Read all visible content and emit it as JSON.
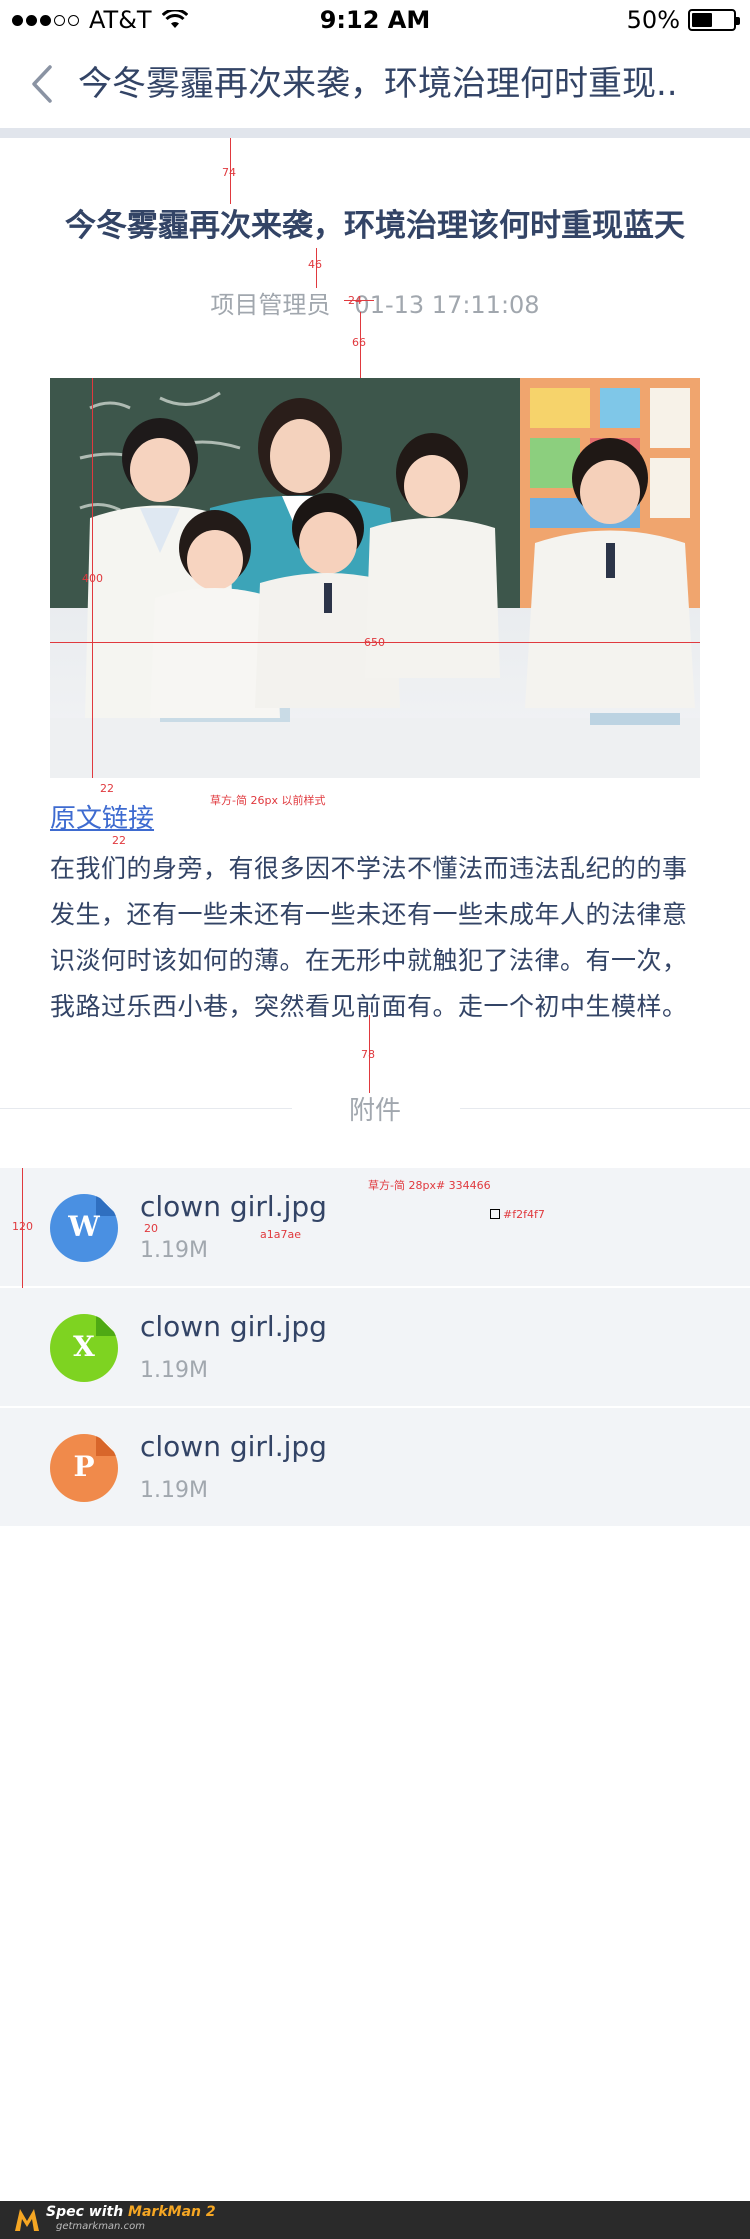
{
  "status_bar": {
    "carrier": "AT&T",
    "time": "9:12 AM",
    "battery": "50%",
    "battery_level": 0.5
  },
  "nav": {
    "title": "今冬雾霾再次来袭，环境治理何时重现.."
  },
  "article": {
    "title": "今冬雾霾再次来袭，环境治理该何时重现蓝天",
    "author": "项目管理员",
    "datetime": "01-13 17:11:08",
    "source_link": "原文链接",
    "body": "在我们的身旁，有很多因不学法不懂法而违法乱纪的的事发生，还有一些未还有一些未还有一些未成年人的法律意识淡何时该如何的薄。在无形中就触犯了法律。有一次，我路过乐西小巷，突然看见前面有。走一个初中生模样。"
  },
  "attachments": {
    "header": "附件",
    "items": [
      {
        "letter": "W",
        "name": "clown girl.jpg",
        "size": "1.19M",
        "color": "#4a90e2",
        "icon": "word-file-icon"
      },
      {
        "letter": "X",
        "name": "clown girl.jpg",
        "size": "1.19M",
        "color": "#7ed321",
        "icon": "excel-file-icon"
      },
      {
        "letter": "P",
        "name": "clown girl.jpg",
        "size": "1.19M",
        "color": "#f08a4b",
        "icon": "powerpoint-file-icon"
      }
    ]
  },
  "annotations": {
    "gap_top": "74",
    "gap_title_meta": "46",
    "gap_author_date": "24",
    "gap_meta_image": "66",
    "image_height": "400",
    "image_width": "650",
    "gap_image_link_1": "22",
    "gap_image_link_2": "22",
    "link_font": "草方-简 26px  以前样式",
    "gap_text_attach": "78",
    "item_height": "120",
    "name_font": "草方-简 28px# 334466",
    "gap_name_size": "20",
    "size_color": "a1a7ae",
    "bg_color": "#f2f4f7"
  },
  "footer": {
    "spec": "Spec with ",
    "brand": "MarkMan 2",
    "site": "getmarkman.com"
  }
}
